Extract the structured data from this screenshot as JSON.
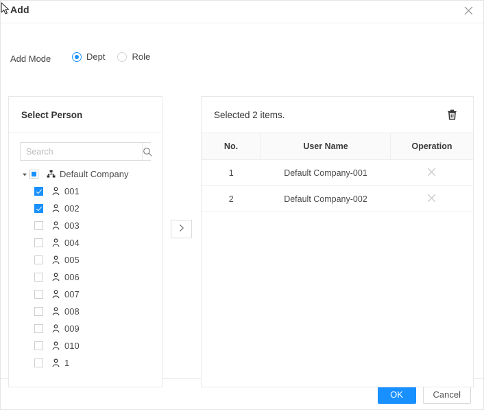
{
  "dialog": {
    "title": "Add",
    "close_icon": "close-icon"
  },
  "mode": {
    "label": "Add Mode",
    "options": [
      {
        "label": "Dept",
        "selected": true
      },
      {
        "label": "Role",
        "selected": false
      }
    ]
  },
  "left_panel": {
    "title": "Select Person",
    "search": {
      "placeholder": "Search",
      "value": "",
      "icon": "search-icon"
    },
    "tree": {
      "root": {
        "label": "Default Company",
        "icon": "org-chart-icon",
        "caret": "caret-down-icon",
        "checkbox_state": "indeterminate"
      },
      "children": [
        {
          "label": "001",
          "icon": "person-icon",
          "checked": true
        },
        {
          "label": "002",
          "icon": "person-icon",
          "checked": true
        },
        {
          "label": "003",
          "icon": "person-icon",
          "checked": false
        },
        {
          "label": "004",
          "icon": "person-icon",
          "checked": false
        },
        {
          "label": "005",
          "icon": "person-icon",
          "checked": false
        },
        {
          "label": "006",
          "icon": "person-icon",
          "checked": false
        },
        {
          "label": "007",
          "icon": "person-icon",
          "checked": false
        },
        {
          "label": "008",
          "icon": "person-icon",
          "checked": false
        },
        {
          "label": "009",
          "icon": "person-icon",
          "checked": false
        },
        {
          "label": "010",
          "icon": "person-icon",
          "checked": false
        },
        {
          "label": "1",
          "icon": "person-icon",
          "checked": false
        }
      ]
    }
  },
  "transfer": {
    "icon": "chevron-right-icon",
    "label": ">"
  },
  "right_panel": {
    "title": "Selected 2 items.",
    "clear_all_icon": "trash-icon",
    "table": {
      "columns": [
        "No.",
        "User Name",
        "Operation"
      ],
      "rows": [
        {
          "no": "1",
          "user_name": "Default Company-001",
          "operation_icon": "close-x-icon"
        },
        {
          "no": "2",
          "user_name": "Default Company-002",
          "operation_icon": "close-x-icon"
        }
      ]
    }
  },
  "footer": {
    "ok_label": "OK",
    "cancel_label": "Cancel"
  },
  "colors": {
    "accent": "#1890ff",
    "border": "#e8e8e8",
    "header_bg": "#fafafa",
    "text": "#333333"
  }
}
